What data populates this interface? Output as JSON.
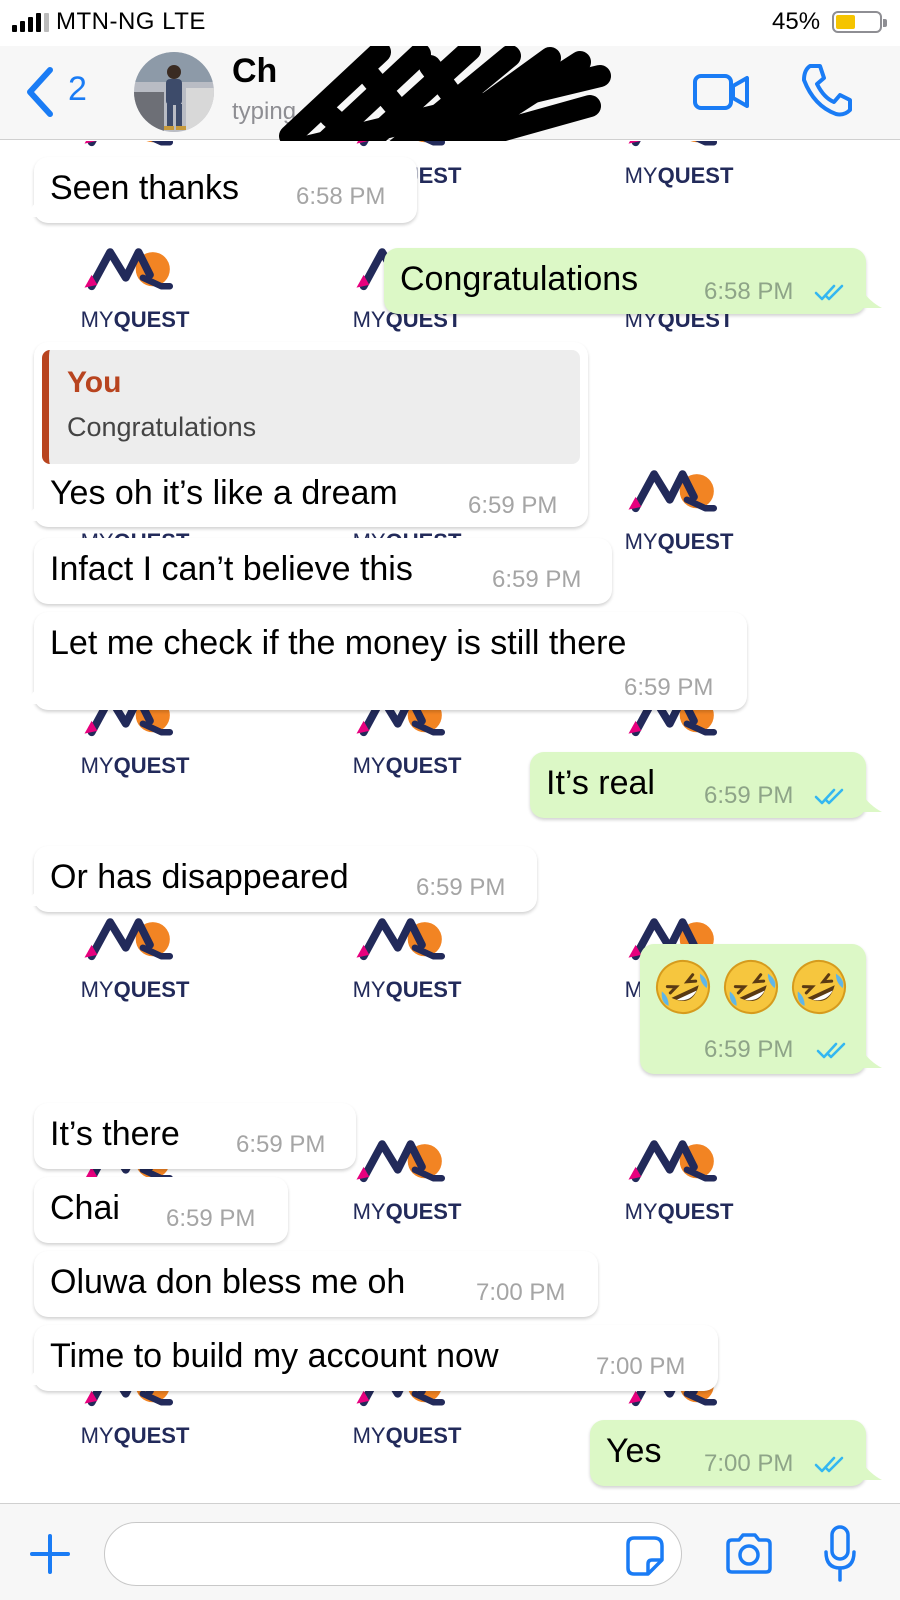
{
  "status_bar": {
    "carrier": "MTN-NG   LTE",
    "battery_percent": "45%",
    "battery_level": 0.45,
    "battery_color": "#f5c400"
  },
  "nav": {
    "back_count": "2",
    "back_icon": "chevron-left-icon",
    "contact_name": "Ch",
    "contact_status": "typing...",
    "video_icon": "video-camera-icon",
    "call_icon": "phone-icon",
    "accent_color": "#1a7cf5"
  },
  "watermark": {
    "text_regular": "MY",
    "text_bold": "QUEST",
    "navy": "#222a5a",
    "orange": "#f28423",
    "pink": "#e6007e"
  },
  "messages": [
    {
      "direction": "in",
      "text": "Seen thanks",
      "time": "6:58 PM"
    },
    {
      "direction": "out",
      "text": "Congratulations",
      "time": "6:58 PM",
      "read": true
    },
    {
      "direction": "in",
      "quote_author": "You",
      "quote_text": "Congratulations",
      "text": "Yes oh it’s like a dream",
      "time": "6:59 PM"
    },
    {
      "direction": "in",
      "text": "Infact I can’t believe this",
      "time": "6:59 PM"
    },
    {
      "direction": "in",
      "text": "Let me check if the money is still there",
      "time": "6:59 PM"
    },
    {
      "direction": "out",
      "text": "It’s real",
      "time": "6:59 PM",
      "read": true
    },
    {
      "direction": "in",
      "text": "Or has disappeared",
      "time": "6:59 PM"
    },
    {
      "direction": "out",
      "emoji": [
        "rolling-on-floor-laughing-emoji",
        "rolling-on-floor-laughing-emoji",
        "rolling-on-floor-laughing-emoji"
      ],
      "time": "6:59 PM",
      "read": true
    },
    {
      "direction": "in",
      "text": "It’s there",
      "time": "6:59 PM"
    },
    {
      "direction": "in",
      "text": "Chai",
      "time": "6:59 PM"
    },
    {
      "direction": "in",
      "text": "Oluwa don bless me oh",
      "time": "7:00 PM"
    },
    {
      "direction": "in",
      "text": "Time to build my account now",
      "time": "7:00 PM"
    },
    {
      "direction": "out",
      "text": "Yes",
      "time": "7:00 PM",
      "read": true
    }
  ],
  "input_bar": {
    "placeholder": "",
    "plus_icon": "plus-icon",
    "sticker_icon": "sticker-icon",
    "camera_icon": "camera-icon",
    "mic_icon": "microphone-icon"
  },
  "colors": {
    "outgoing_bubble": "#dcf8c6",
    "incoming_bubble": "#ffffff",
    "read_ticks": "#34b7f1",
    "reply_accent": "#b8441f"
  }
}
